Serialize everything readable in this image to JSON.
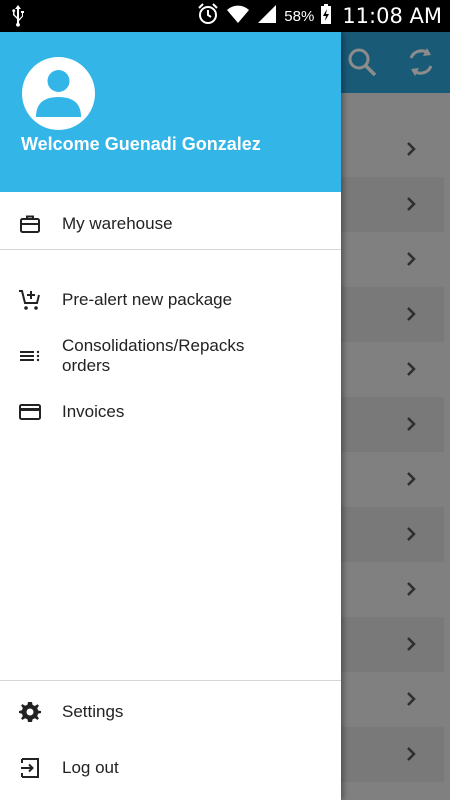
{
  "status_bar": {
    "battery_percent": "58%",
    "time": "11:08 AM",
    "icons": [
      "usb-icon",
      "alarm-icon",
      "wifi-icon",
      "signal-icon",
      "battery-charging-icon"
    ]
  },
  "toolbar": {
    "icons": [
      "search-icon",
      "refresh-icon"
    ],
    "color": "#2ea4d9"
  },
  "drawer": {
    "header_color": "#33b5e8",
    "welcome": "Welcome Guenadi Gonzalez",
    "items": [
      {
        "label": "My warehouse",
        "icon": "briefcase-icon"
      },
      {
        "label": "Pre-alert new package",
        "icon": "add-cart-icon"
      },
      {
        "label": "Consolidations/Repacks orders",
        "icon": "list-icon"
      },
      {
        "label": "Invoices",
        "icon": "card-icon"
      },
      {
        "label": "Settings",
        "icon": "gear-icon"
      },
      {
        "label": "Log out",
        "icon": "logout-icon"
      }
    ]
  }
}
